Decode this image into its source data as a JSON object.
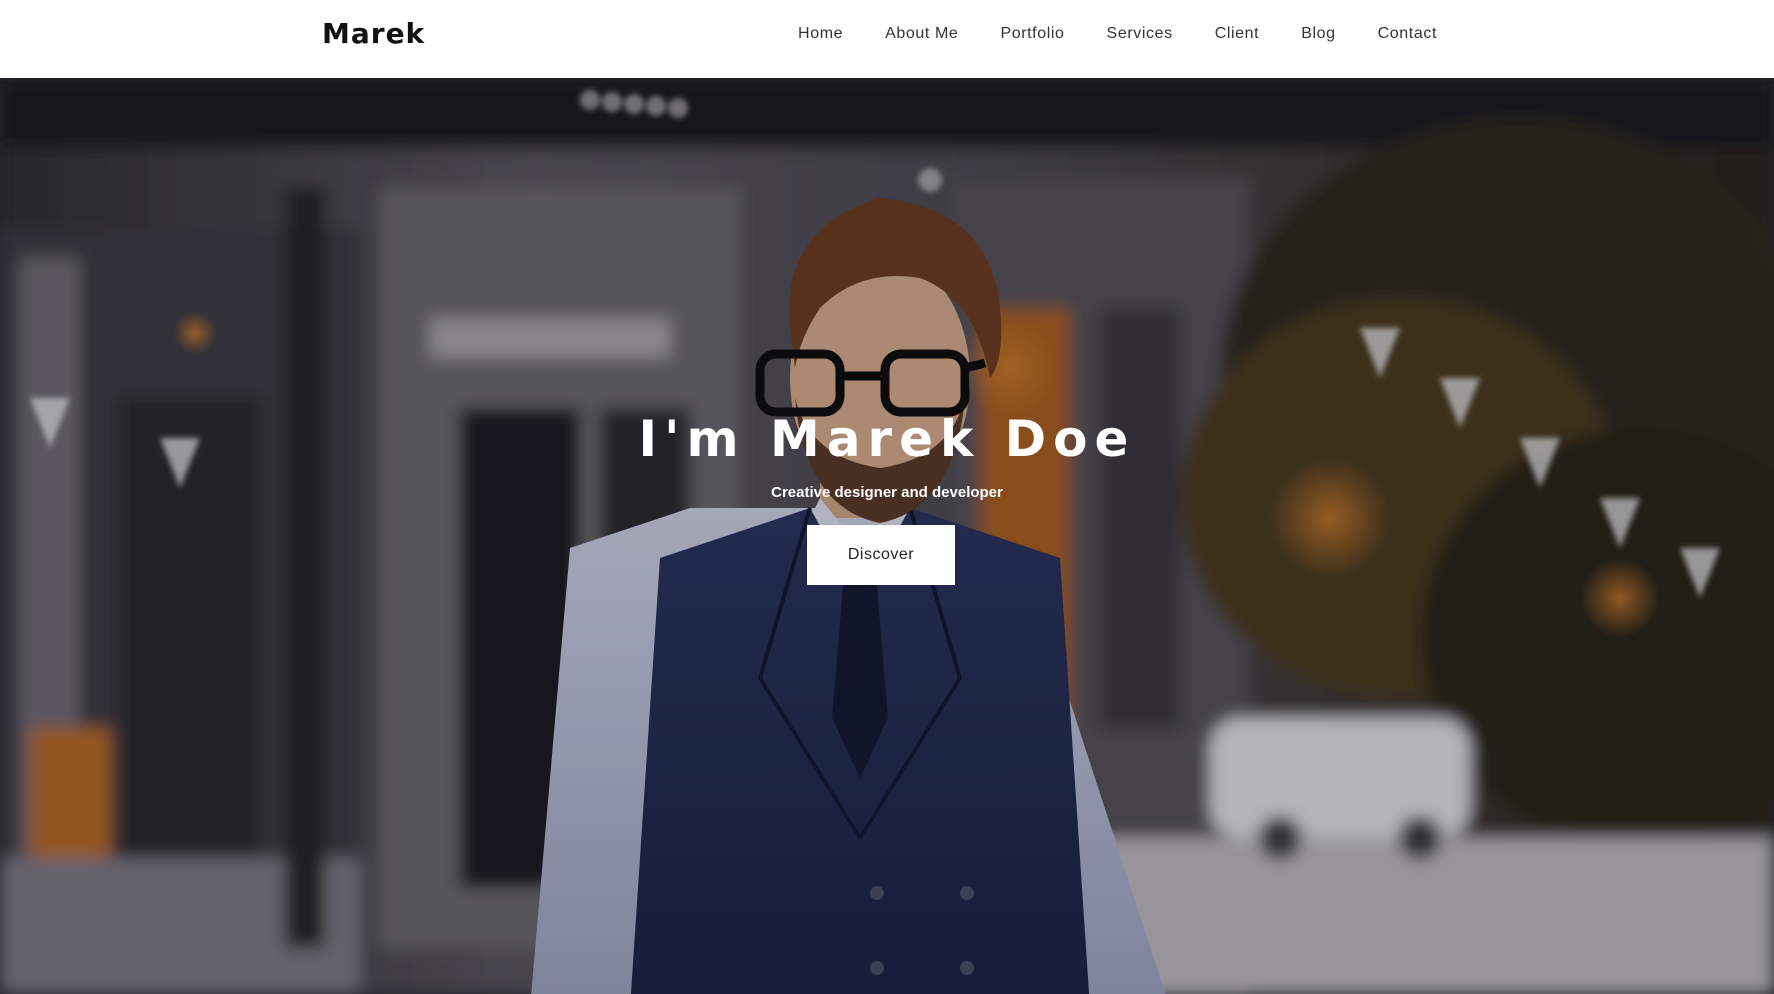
{
  "brand": {
    "logo": "Marek"
  },
  "nav": {
    "items": [
      "Home",
      "About Me",
      "Portfolio",
      "Services",
      "Client",
      "Blog",
      "Contact"
    ]
  },
  "hero": {
    "title": "I'm Marek Doe",
    "subtitle": "Creative designer and developer",
    "button_label": "Discover",
    "background_image": "blurred street photo of a man in glasses, white shirt, navy waistcoat and tie"
  },
  "colors": {
    "navbar_bg": "#ffffff",
    "nav_text": "#333333",
    "logo_text": "#111111",
    "hero_text": "#ffffff",
    "button_bg": "#ffffff"
  }
}
